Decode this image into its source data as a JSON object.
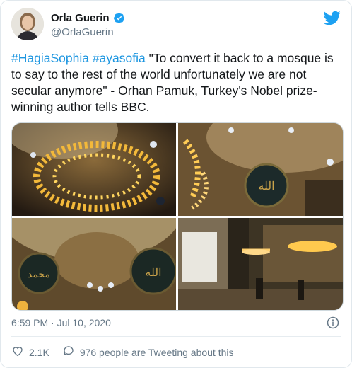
{
  "tweet": {
    "author_name": "Orla Guerin",
    "author_handle": "@OrlaGuerin",
    "verified": true,
    "hashtag1": "#HagiaSophia",
    "hashtag2": "#ayasofia",
    "body": " \"To convert it back to a mosque is to say to the rest of the world unfortunately we are not secular anymore\" - Orhan Pamuk, Turkey's Nobel prize-winning author tells BBC.",
    "timestamp": "6:59 PM · Jul 10, 2020",
    "like_count": "2.1K",
    "conversation_text": "976 people are Tweeting about this"
  },
  "icons": {
    "verified": "verified-badge-icon",
    "bird": "twitter-bird-icon",
    "info": "info-icon",
    "like": "heart-icon",
    "conversation": "speech-bubble-icon"
  },
  "colors": {
    "link": "#1b95e0",
    "verified": "#1da1f2",
    "secondary_text": "#657786",
    "like": "#e0245e"
  }
}
